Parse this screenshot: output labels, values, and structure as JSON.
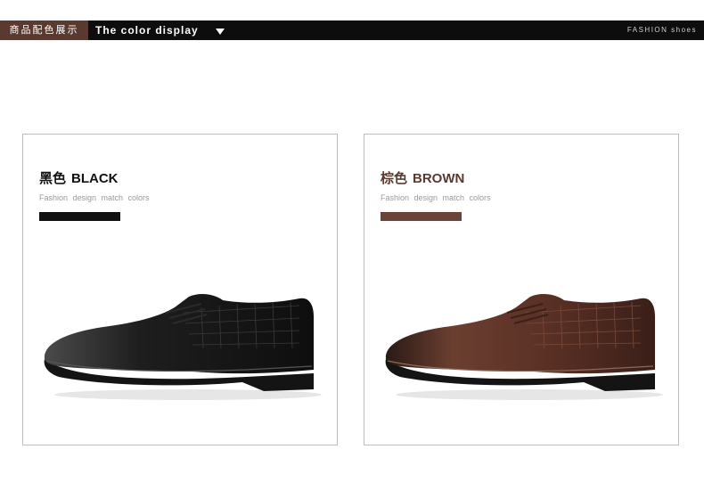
{
  "header": {
    "cn_label": "商品配色展示",
    "en_title": "The color display",
    "brand": "FASHION shoes"
  },
  "colors": [
    {
      "cn": "黑色",
      "en": "BLACK",
      "subtitle": "Fashion design match colors",
      "swatch": "#111111",
      "title_color": "#111111"
    },
    {
      "cn": "棕色",
      "en": "BROWN",
      "subtitle": "Fashion design match colors",
      "swatch": "#6b4339",
      "title_color": "#5a3a30"
    }
  ],
  "accent": "#5a3a30",
  "bar": "#0d0d0d"
}
